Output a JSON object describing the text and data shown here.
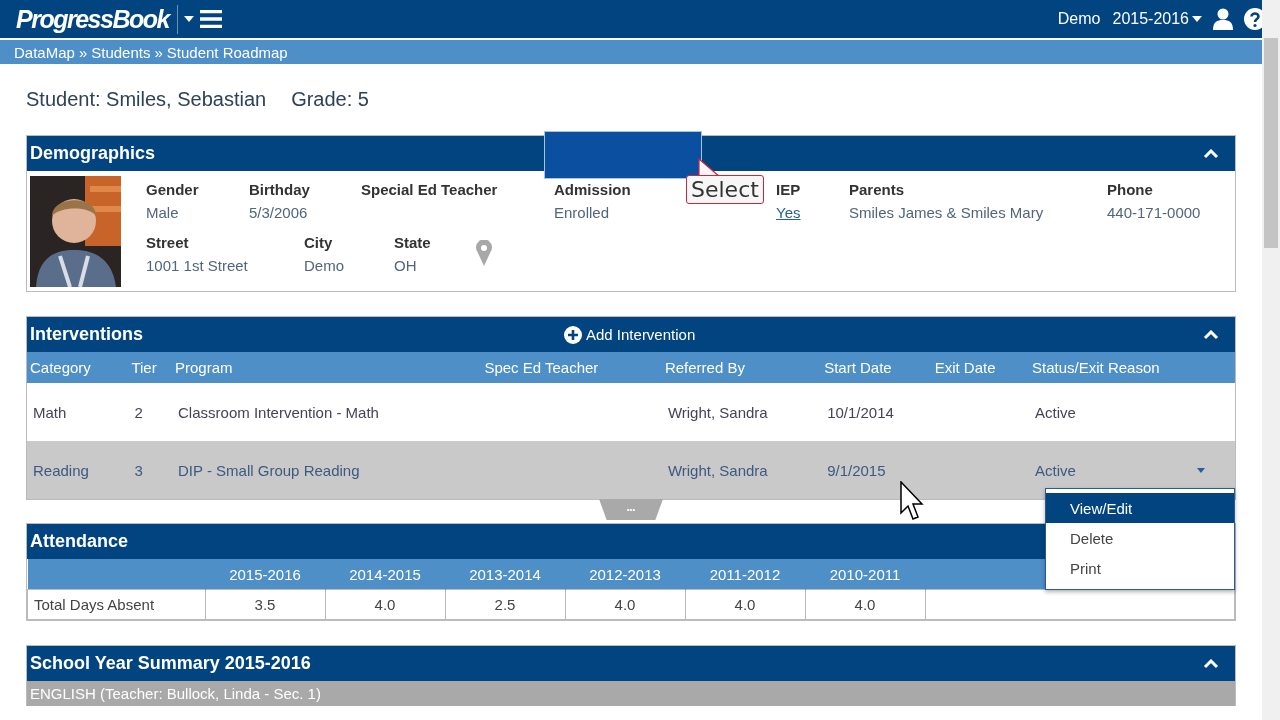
{
  "header": {
    "logo": "ProgressBook",
    "user": "Demo",
    "year": "2015-2016"
  },
  "breadcrumb": [
    "DataMap",
    "Students",
    "Student Roadmap"
  ],
  "breadcrumb_separator": "»",
  "student": {
    "name": "Student: Smiles, Sebastian",
    "grade": "Grade: 5"
  },
  "demographics": {
    "title": "Demographics",
    "rows": [
      [
        {
          "label": "Gender",
          "value": "Male"
        },
        {
          "label": "Birthday",
          "value": "5/3/2006"
        },
        {
          "label": "Special Ed Teacher"
        },
        {
          "label": "Admission",
          "value": "Enrolled"
        },
        {
          "label": "IEP",
          "value": "Yes",
          "link": true
        },
        {
          "label": "Parents",
          "value": "Smiles James & Smiles Mary"
        },
        {
          "label": "Phone",
          "value": "440-171-0000"
        }
      ],
      [
        {
          "label": "Street",
          "value": "1001 1st Street"
        },
        {
          "label": "City",
          "value": "Demo"
        },
        {
          "label": "State",
          "value": "OH"
        }
      ]
    ]
  },
  "callout": {
    "text": "Select"
  },
  "interventions": {
    "title": "Interventions",
    "add": "Add Intervention",
    "columns": [
      "Category",
      "Tier",
      "Program",
      "Spec Ed Teacher",
      "Referred By",
      "Start Date",
      "Exit Date",
      "Status/Exit Reason"
    ],
    "rows": [
      {
        "cells": [
          "Math",
          "2",
          "Classroom Intervention - Math",
          "",
          "Wright, Sandra",
          "10/1/2014",
          "",
          "Active"
        ],
        "selected": false
      },
      {
        "cells": [
          "Reading",
          "3",
          "DIP - Small Group Reading",
          "",
          "Wright, Sandra",
          "9/1/2015",
          "",
          "Active"
        ],
        "selected": true
      }
    ],
    "more": "•••",
    "menu": [
      {
        "label": "View/Edit",
        "selected": true
      },
      {
        "label": "Delete",
        "selected": false
      },
      {
        "label": "Print",
        "selected": false
      }
    ]
  },
  "attendance": {
    "title": "Attendance",
    "columns": [
      "2015-2016",
      "2014-2015",
      "2013-2014",
      "2012-2013",
      "2011-2012",
      "2010-2011"
    ],
    "rows": [
      {
        "label": "Total Days Absent",
        "values": [
          "3.5",
          "4.0",
          "2.5",
          "4.0",
          "4.0",
          "4.0"
        ]
      }
    ]
  },
  "summary": {
    "title": "School Year Summary 2015-2016",
    "subtitle": "ENGLISH (Teacher: Bullock, Linda - Sec. 1)"
  }
}
